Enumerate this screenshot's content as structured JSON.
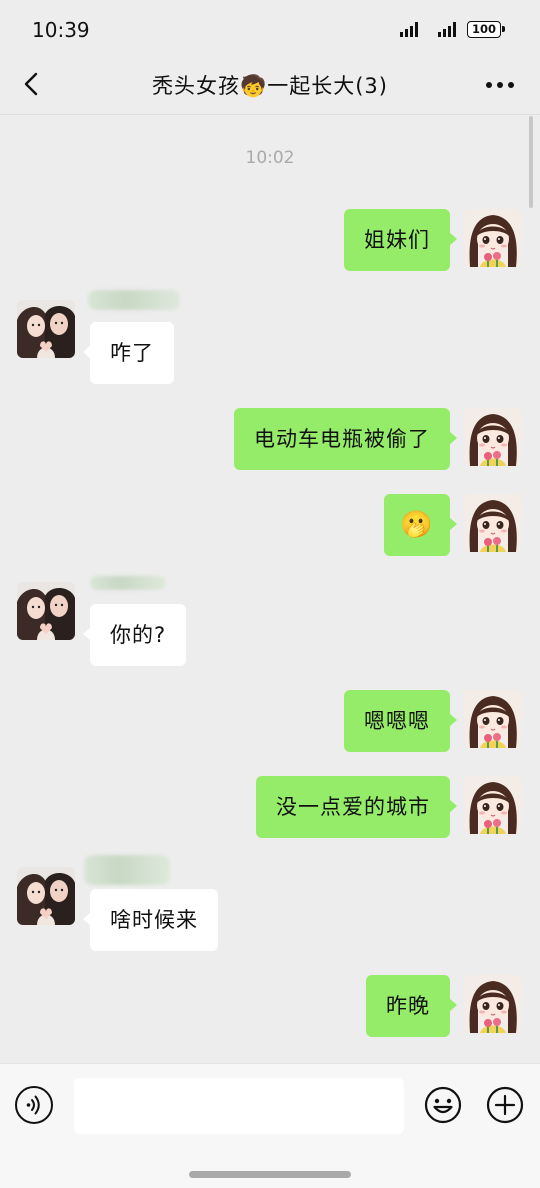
{
  "status_bar": {
    "time": "10:39",
    "battery": "100"
  },
  "header": {
    "title": "秃头女孩",
    "title_emoji": "🧒",
    "title_suffix": "一起长大(3)"
  },
  "timestamp": "10:02",
  "messages": [
    {
      "side": "me",
      "text": "姐妹们"
    },
    {
      "side": "other",
      "text": "咋了"
    },
    {
      "side": "me",
      "text": "电动车电瓶被偷了"
    },
    {
      "side": "me",
      "text": "",
      "emoji": "🫢"
    },
    {
      "side": "other",
      "text": "你的?"
    },
    {
      "side": "me",
      "text": "嗯嗯嗯"
    },
    {
      "side": "me",
      "text": "没一点爱的城市"
    },
    {
      "side": "other",
      "text": "啥时候来"
    },
    {
      "side": "me",
      "text": "昨晚"
    }
  ],
  "colors": {
    "my_bubble": "#95ec69",
    "other_bubble": "#ffffff",
    "background": "#ededed"
  },
  "icons": [
    "back-icon",
    "more-icon",
    "voice-icon",
    "emoji-icon",
    "plus-icon"
  ]
}
